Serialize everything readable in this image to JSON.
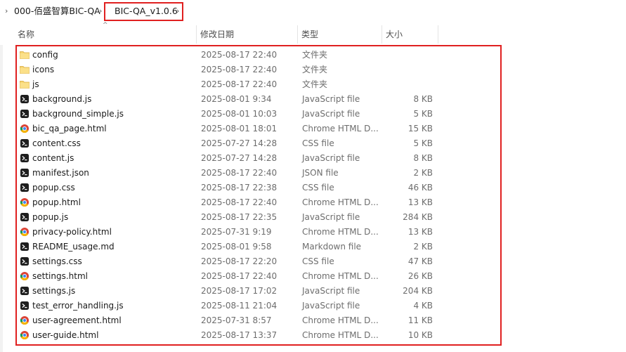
{
  "breadcrumb": {
    "items": [
      {
        "label": "000-佰盛智算BIC-QA"
      },
      {
        "label": "BIC-QA_v1.0.6"
      }
    ]
  },
  "columns": {
    "name": "名称",
    "date": "修改日期",
    "type": "类型",
    "size": "大小"
  },
  "files": [
    {
      "name": "config",
      "date": "2025-08-17 22:40",
      "type": "文件夹",
      "size": "",
      "icon": "folder-icon"
    },
    {
      "name": "icons",
      "date": "2025-08-17 22:40",
      "type": "文件夹",
      "size": "",
      "icon": "folder-icon"
    },
    {
      "name": "js",
      "date": "2025-08-17 22:40",
      "type": "文件夹",
      "size": "",
      "icon": "folder-icon"
    },
    {
      "name": "background.js",
      "date": "2025-08-01 9:34",
      "type": "JavaScript file",
      "size": "8 KB",
      "icon": "code-file-icon"
    },
    {
      "name": "background_simple.js",
      "date": "2025-08-01 10:03",
      "type": "JavaScript file",
      "size": "5 KB",
      "icon": "code-file-icon"
    },
    {
      "name": "bic_qa_page.html",
      "date": "2025-08-01 18:01",
      "type": "Chrome HTML D...",
      "size": "15 KB",
      "icon": "chrome-icon"
    },
    {
      "name": "content.css",
      "date": "2025-07-27 14:28",
      "type": "CSS file",
      "size": "5 KB",
      "icon": "code-file-icon"
    },
    {
      "name": "content.js",
      "date": "2025-07-27 14:28",
      "type": "JavaScript file",
      "size": "8 KB",
      "icon": "code-file-icon"
    },
    {
      "name": "manifest.json",
      "date": "2025-08-17 22:40",
      "type": "JSON file",
      "size": "2 KB",
      "icon": "code-file-icon"
    },
    {
      "name": "popup.css",
      "date": "2025-08-17 22:38",
      "type": "CSS file",
      "size": "46 KB",
      "icon": "code-file-icon"
    },
    {
      "name": "popup.html",
      "date": "2025-08-17 22:40",
      "type": "Chrome HTML D...",
      "size": "13 KB",
      "icon": "chrome-icon"
    },
    {
      "name": "popup.js",
      "date": "2025-08-17 22:35",
      "type": "JavaScript file",
      "size": "284 KB",
      "icon": "code-file-icon"
    },
    {
      "name": "privacy-policy.html",
      "date": "2025-07-31 9:19",
      "type": "Chrome HTML D...",
      "size": "13 KB",
      "icon": "chrome-icon"
    },
    {
      "name": "README_usage.md",
      "date": "2025-08-01 9:58",
      "type": "Markdown file",
      "size": "2 KB",
      "icon": "code-file-icon"
    },
    {
      "name": "settings.css",
      "date": "2025-08-17 22:20",
      "type": "CSS file",
      "size": "47 KB",
      "icon": "code-file-icon"
    },
    {
      "name": "settings.html",
      "date": "2025-08-17 22:40",
      "type": "Chrome HTML D...",
      "size": "26 KB",
      "icon": "chrome-icon"
    },
    {
      "name": "settings.js",
      "date": "2025-08-17 17:02",
      "type": "JavaScript file",
      "size": "204 KB",
      "icon": "code-file-icon"
    },
    {
      "name": "test_error_handling.js",
      "date": "2025-08-11 21:04",
      "type": "JavaScript file",
      "size": "4 KB",
      "icon": "code-file-icon"
    },
    {
      "name": "user-agreement.html",
      "date": "2025-07-31 8:57",
      "type": "Chrome HTML D...",
      "size": "11 KB",
      "icon": "chrome-icon"
    },
    {
      "name": "user-guide.html",
      "date": "2025-08-17 13:37",
      "type": "Chrome HTML D...",
      "size": "10 KB",
      "icon": "chrome-icon"
    }
  ],
  "colors": {
    "highlight": "#e02020",
    "folder": "#f6d36b",
    "code_icon": "#1e1e1e"
  }
}
